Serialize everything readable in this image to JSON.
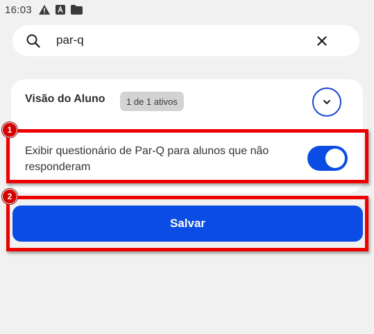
{
  "status_bar": {
    "time": "16:03",
    "icons": [
      "warning-icon",
      "app-a-icon",
      "folder-icon"
    ]
  },
  "search": {
    "value": "par-q",
    "icon": "search-icon",
    "clear_icon": "close-icon"
  },
  "section": {
    "title": "Visão do Aluno",
    "badge": "1 de 1 ativos",
    "expand_icon": "chevron-down-icon",
    "setting": {
      "label": "Exibir questionário de Par-Q para alunos que não responderam",
      "enabled": true
    }
  },
  "save_button": {
    "label": "Salvar"
  },
  "annotations": [
    {
      "number": "1"
    },
    {
      "number": "2"
    }
  ],
  "colors": {
    "accent": "#0b4ce4",
    "annotation": "#ee0000",
    "background": "#f1f1f1",
    "card": "#ffffff"
  }
}
